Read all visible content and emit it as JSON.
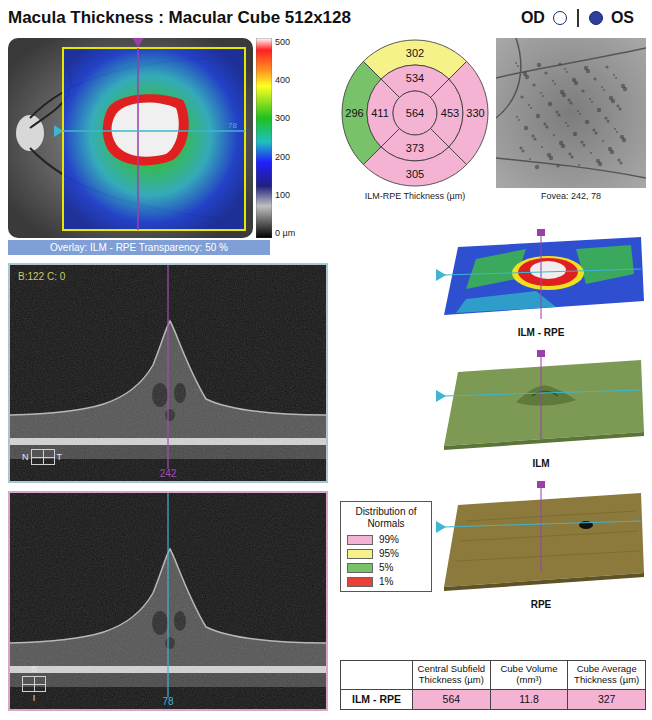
{
  "header": {
    "title": "Macula Thickness : Macular Cube 512x128",
    "eyes": [
      {
        "label": "OD",
        "selected": false
      },
      {
        "label": "OS",
        "selected": true
      }
    ]
  },
  "thickness_map": {
    "scan_marker": "78",
    "scale_ticks": [
      "500",
      "400",
      "300",
      "200",
      "100",
      "0 µm"
    ],
    "overlay_label": "Overlay: ILM - RPE Transparency: 50 %"
  },
  "etdrs": {
    "caption": "ILM-RPE Thickness (µm)",
    "sectors": [
      {
        "ring": "outer",
        "side": "top",
        "value": "302",
        "color": "#f6f28a"
      },
      {
        "ring": "inner",
        "side": "top",
        "value": "534",
        "color": "#f5b3d3"
      },
      {
        "ring": "outer",
        "side": "left",
        "value": "296",
        "color": "#78c26a"
      },
      {
        "ring": "inner",
        "side": "left",
        "value": "411",
        "color": "#f5b3d3"
      },
      {
        "ring": "center",
        "side": "center",
        "value": "564",
        "color": "#f5b3d3"
      },
      {
        "ring": "inner",
        "side": "right",
        "value": "453",
        "color": "#f5b3d3"
      },
      {
        "ring": "outer",
        "side": "right",
        "value": "330",
        "color": "#f5b3d3"
      },
      {
        "ring": "inner",
        "side": "bottom",
        "value": "373",
        "color": "#f5b3d3"
      },
      {
        "ring": "outer",
        "side": "bottom",
        "value": "305",
        "color": "#f5b3d3"
      }
    ]
  },
  "fundus": {
    "caption": "Fovea: 242, 78"
  },
  "bscans": [
    {
      "corner_text": "B:122 C: 0",
      "position": "242",
      "orientation": {
        "axis": "horizontal",
        "labels": [
          "N",
          "T"
        ]
      },
      "frame_color": "#a9c6d6",
      "line_color": "#a54fb2"
    },
    {
      "position": "78",
      "orientation": {
        "axis": "vertical",
        "labels": [
          "S",
          "I"
        ]
      },
      "frame_color": "#d9a6c8",
      "line_color": "#3fb6d1"
    }
  ],
  "surfaces": [
    {
      "kind": "thickness",
      "label": "ILM - RPE"
    },
    {
      "kind": "ilm",
      "label": "ILM"
    },
    {
      "kind": "rpe",
      "label": "RPE"
    }
  ],
  "legend": {
    "title": "Distribution of Normals",
    "items": [
      {
        "label": "99%",
        "color": "#f5b3d3"
      },
      {
        "label": "95%",
        "color": "#f6f28a"
      },
      {
        "label": "5%",
        "color": "#78c26a"
      },
      {
        "label": "1%",
        "color": "#e8413a"
      }
    ]
  },
  "table": {
    "columns": [
      "Central Subfield Thickness (µm)",
      "Cube Volume (mm³)",
      "Cube Average Thickness (µm)"
    ],
    "rows": [
      {
        "label": "ILM - RPE",
        "cells": [
          {
            "value": "564",
            "color": "#f5b3d3"
          },
          {
            "value": "11.8",
            "color": "#f5b3d3"
          },
          {
            "value": "327",
            "color": "#f5b3d3"
          }
        ]
      }
    ]
  }
}
